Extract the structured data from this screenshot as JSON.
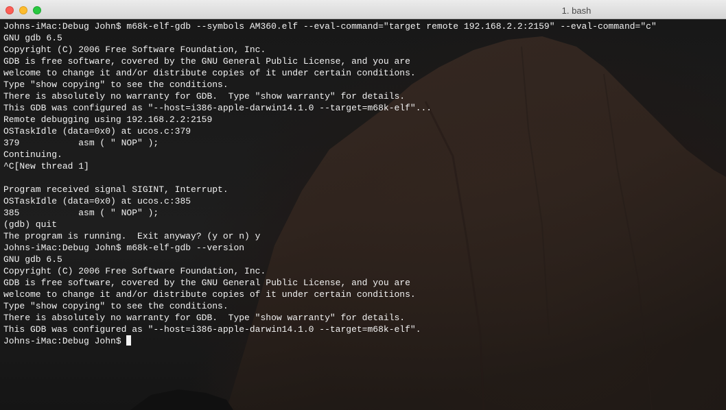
{
  "window": {
    "title": "1. bash"
  },
  "terminal": {
    "lines": [
      "Johns-iMac:Debug John$ m68k-elf-gdb --symbols AM360.elf --eval-command=\"target remote 192.168.2.2:2159\" --eval-command=\"c\"",
      "GNU gdb 6.5",
      "Copyright (C) 2006 Free Software Foundation, Inc.",
      "GDB is free software, covered by the GNU General Public License, and you are",
      "welcome to change it and/or distribute copies of it under certain conditions.",
      "Type \"show copying\" to see the conditions.",
      "There is absolutely no warranty for GDB.  Type \"show warranty\" for details.",
      "This GDB was configured as \"--host=i386-apple-darwin14.1.0 --target=m68k-elf\"...",
      "Remote debugging using 192.168.2.2:2159",
      "OSTaskIdle (data=0x0) at ucos.c:379",
      "379           asm ( \" NOP\" );",
      "Continuing.",
      "^C[New thread 1]",
      "",
      "Program received signal SIGINT, Interrupt.",
      "OSTaskIdle (data=0x0) at ucos.c:385",
      "385           asm ( \" NOP\" );",
      "(gdb) quit",
      "The program is running.  Exit anyway? (y or n) y",
      "Johns-iMac:Debug John$ m68k-elf-gdb --version",
      "GNU gdb 6.5",
      "Copyright (C) 2006 Free Software Foundation, Inc.",
      "GDB is free software, covered by the GNU General Public License, and you are",
      "welcome to change it and/or distribute copies of it under certain conditions.",
      "Type \"show copying\" to see the conditions.",
      "There is absolutely no warranty for GDB.  Type \"show warranty\" for details.",
      "This GDB was configured as \"--host=i386-apple-darwin14.1.0 --target=m68k-elf\"."
    ],
    "prompt": "Johns-iMac:Debug John$ "
  },
  "colors": {
    "text": "#f2f2f2",
    "background": "#1b1b1b",
    "close": "#fc5f57",
    "minimize": "#fdbc2e",
    "zoom": "#28c840"
  }
}
